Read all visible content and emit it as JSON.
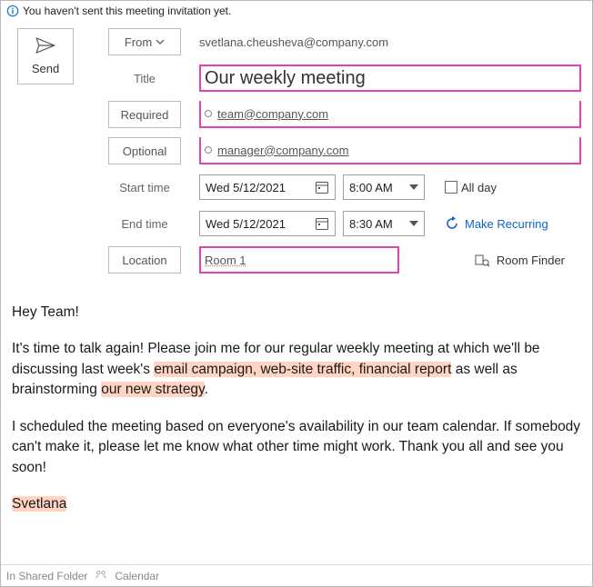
{
  "notice": "You haven't sent this meeting invitation yet.",
  "send_label": "Send",
  "fields": {
    "from": "From",
    "title": "Title",
    "required": "Required",
    "optional": "Optional",
    "start": "Start time",
    "end": "End time",
    "location": "Location"
  },
  "values": {
    "from_email": "svetlana.cheusheva@company.com",
    "title": "Our weekly meeting",
    "required_email": "team@company.com",
    "optional_email": "manager@company.com",
    "start_date": "Wed 5/12/2021",
    "start_time": "8:00 AM",
    "end_date": "Wed 5/12/2021",
    "end_time": "8:30 AM",
    "location": "Room 1"
  },
  "options": {
    "all_day": "All day",
    "make_recurring": "Make Recurring",
    "room_finder": "Room Finder"
  },
  "body": {
    "greeting": "Hey Team!",
    "p1_a": "It's time to talk again! Please join me for our regular weekly meeting at which we'll be discussing last week's ",
    "p1_h1": "email campaign, web-site traffic, financial report",
    "p1_b": " as well as brainstorming ",
    "p1_h2": "our new strategy",
    "p1_c": ".",
    "p2": "I scheduled the meeting based on everyone's availability in our team calendar. If somebody can't make it, please let me know what other time might work. Thank you all and see you soon!",
    "signature": "Svetlana"
  },
  "footer": {
    "folder_label": "In Shared Folder",
    "calendar_label": "Calendar"
  }
}
